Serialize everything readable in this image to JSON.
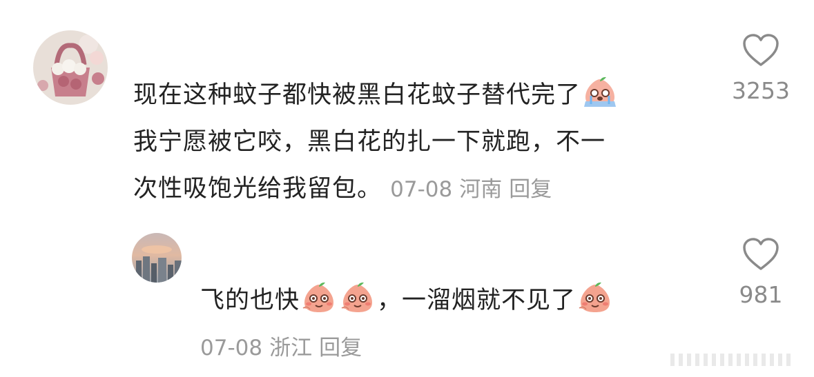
{
  "comments": [
    {
      "lines": [
        "现在这种蚊子都快被黑白花蚊子替代完了",
        "我宁愿被它咬，黑白花的扎一下就跑，不一",
        "次性吸饱光给我留包。"
      ],
      "date": "07-08",
      "location": "河南",
      "reply_label": "回复",
      "likes": "3253",
      "emoji": "crying-peach-emoji"
    },
    {
      "text_a": "飞的也快",
      "text_b": "，一溜烟就不见了",
      "date": "07-08",
      "location": "浙江",
      "reply_label": "回复",
      "likes": "981",
      "emoji": "blushing-peach-emoji"
    }
  ],
  "colors": {
    "text": "#222222",
    "meta": "#9a9a9a",
    "like_icon": "#8a8a8a",
    "emoji_peach": "#f4a38f"
  }
}
